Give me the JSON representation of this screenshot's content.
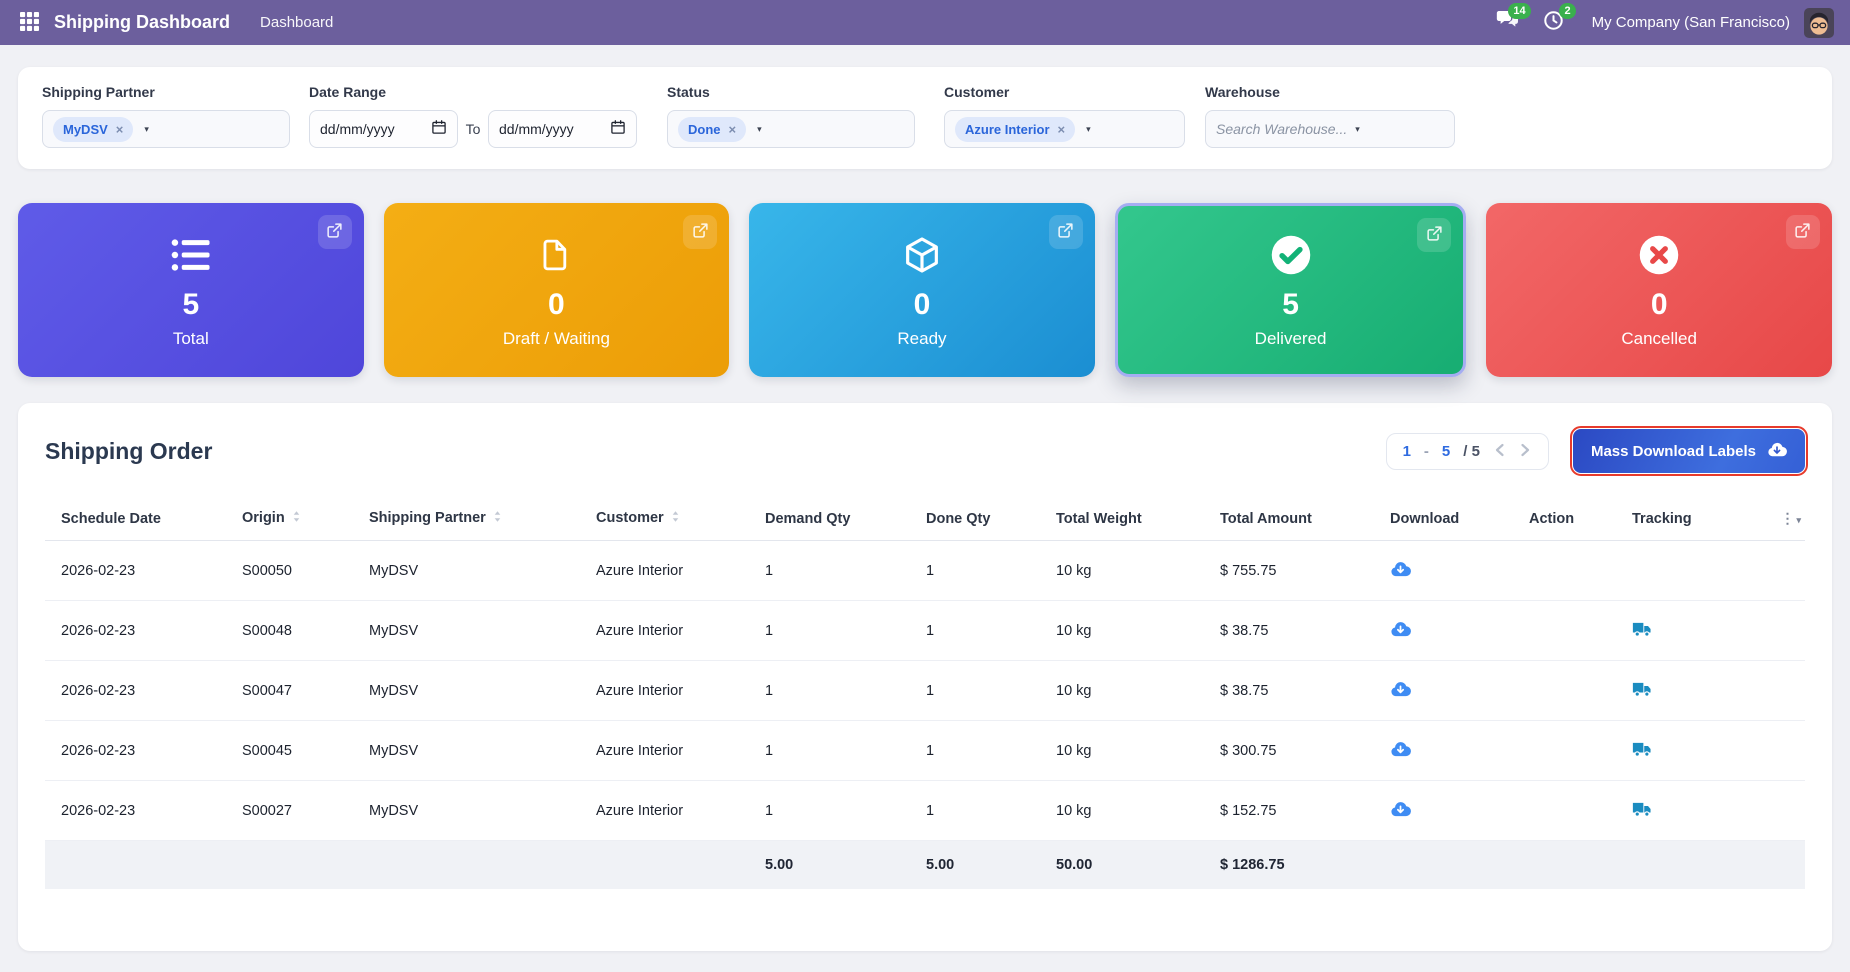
{
  "navbar": {
    "app_title": "Shipping Dashboard",
    "menu_item": "Dashboard",
    "messages_badge": "14",
    "activities_badge": "2",
    "company": "My Company (San Francisco)"
  },
  "icons": {
    "remove": "×",
    "caret_down": "▾",
    "kebab": "⋮"
  },
  "filters": {
    "shipping_partner": {
      "label": "Shipping Partner",
      "tag": "MyDSV"
    },
    "date_range": {
      "label": "Date Range",
      "from_placeholder": "dd/mm/yyyy",
      "separator": "To",
      "to_placeholder": "dd/mm/yyyy"
    },
    "status": {
      "label": "Status",
      "tag": "Done"
    },
    "customer": {
      "label": "Customer",
      "tag": "Azure Interior"
    },
    "warehouse": {
      "label": "Warehouse",
      "placeholder": "Search Warehouse..."
    }
  },
  "stat_cards": [
    {
      "label": "Total",
      "value": "5",
      "icon": "list-icon",
      "gradient": [
        "#5f5be8",
        "#4f46da"
      ],
      "selected": false
    },
    {
      "label": "Draft / Waiting",
      "value": "0",
      "icon": "file-icon",
      "gradient": [
        "#f4ae14",
        "#ec9d07"
      ],
      "selected": false
    },
    {
      "label": "Ready",
      "value": "0",
      "icon": "cube-icon",
      "gradient": [
        "#38b6ea",
        "#1b8ed2"
      ],
      "selected": false
    },
    {
      "label": "Delivered",
      "value": "5",
      "icon": "check-circle-icon",
      "gradient": [
        "#33c78d",
        "#17ad72"
      ],
      "selected": true
    },
    {
      "label": "Cancelled",
      "value": "0",
      "icon": "x-circle-icon",
      "gradient": [
        "#f26767",
        "#e74848"
      ],
      "selected": false
    }
  ],
  "colors": {
    "navbar": "#6c5f9d",
    "badge_green": "#3ab04d",
    "accent_blue": "#2f6be0",
    "download_icon": "#3f8cf3",
    "tracking_icon": "#1b8cc0",
    "selected_card_border": "#a5adf2",
    "button_highlight_outline": "#e73b2c"
  },
  "orders": {
    "title": "Shipping Order",
    "pagination": {
      "start": "1",
      "dash": "-",
      "end": "5",
      "total": "/ 5"
    },
    "mass_download_label": "Mass Download Labels",
    "table": {
      "columns": [
        {
          "label": "Schedule Date",
          "sortable": false
        },
        {
          "label": "Origin",
          "sortable": true
        },
        {
          "label": "Shipping Partner",
          "sortable": true
        },
        {
          "label": "Customer",
          "sortable": true
        },
        {
          "label": "Demand Qty",
          "sortable": false
        },
        {
          "label": "Done Qty",
          "sortable": false
        },
        {
          "label": "Total Weight",
          "sortable": false
        },
        {
          "label": "Total Amount",
          "sortable": false
        },
        {
          "label": "Download",
          "sortable": false
        },
        {
          "label": "Action",
          "sortable": false
        },
        {
          "label": "Tracking",
          "sortable": false
        }
      ],
      "rows": [
        {
          "schedule_date": "2026-02-23",
          "origin": "S00050",
          "partner": "MyDSV",
          "customer": "Azure Interior",
          "demand_qty": "1",
          "done_qty": "1",
          "total_weight": "10 kg",
          "total_amount": "$ 755.75",
          "download": true,
          "tracking": false
        },
        {
          "schedule_date": "2026-02-23",
          "origin": "S00048",
          "partner": "MyDSV",
          "customer": "Azure Interior",
          "demand_qty": "1",
          "done_qty": "1",
          "total_weight": "10 kg",
          "total_amount": "$ 38.75",
          "download": true,
          "tracking": true
        },
        {
          "schedule_date": "2026-02-23",
          "origin": "S00047",
          "partner": "MyDSV",
          "customer": "Azure Interior",
          "demand_qty": "1",
          "done_qty": "1",
          "total_weight": "10 kg",
          "total_amount": "$ 38.75",
          "download": true,
          "tracking": true
        },
        {
          "schedule_date": "2026-02-23",
          "origin": "S00045",
          "partner": "MyDSV",
          "customer": "Azure Interior",
          "demand_qty": "1",
          "done_qty": "1",
          "total_weight": "10 kg",
          "total_amount": "$ 300.75",
          "download": true,
          "tracking": true
        },
        {
          "schedule_date": "2026-02-23",
          "origin": "S00027",
          "partner": "MyDSV",
          "customer": "Azure Interior",
          "demand_qty": "1",
          "done_qty": "1",
          "total_weight": "10 kg",
          "total_amount": "$ 152.75",
          "download": true,
          "tracking": true
        }
      ],
      "totals": {
        "demand_qty": "5.00",
        "done_qty": "5.00",
        "total_weight": "50.00",
        "total_amount": "$ 1286.75"
      }
    }
  }
}
